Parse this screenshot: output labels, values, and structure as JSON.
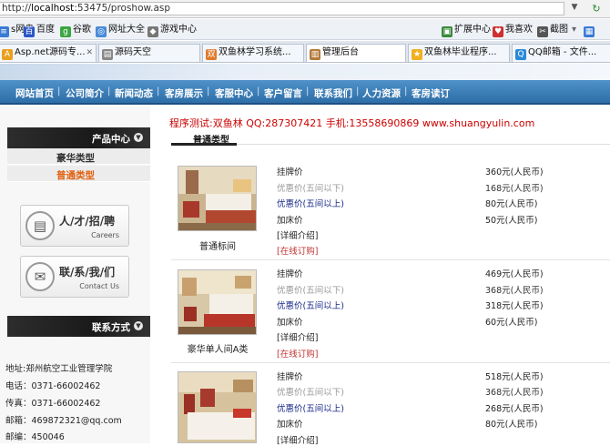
{
  "browser": {
    "url_prefix": "http://",
    "url_host": "localhost",
    "url_rest": ":53475/proshow.asp",
    "bookmarks_left": [
      {
        "label": "s网盘",
        "icon": "disk-icon",
        "color": "#3a7bd5"
      },
      {
        "label": "百度",
        "icon": "baidu-icon",
        "color": "#2b55c8"
      },
      {
        "label": "谷歌",
        "icon": "google-icon",
        "color": "#3aa640"
      },
      {
        "label": "网址大全",
        "icon": "globe-icon",
        "color": "#4a8ad8"
      },
      {
        "label": "游戏中心",
        "icon": "gamepad-icon",
        "color": "#777777"
      }
    ],
    "bookmarks_right": [
      {
        "label": "扩展中心",
        "icon": "extension-icon",
        "color": "#3a8a3a"
      },
      {
        "label": "我喜欢",
        "icon": "heart-icon",
        "color": "#d03030"
      },
      {
        "label": "截图",
        "icon": "scissors-icon",
        "color": "#555555"
      }
    ],
    "tabs": [
      {
        "label": "Asp.net源码专...",
        "icon": "page-icon"
      },
      {
        "label": "源码天空",
        "icon": "page-icon"
      },
      {
        "label": "双鱼林学习系统...",
        "icon": "page-icon"
      },
      {
        "label": "管理后台",
        "icon": "page-icon"
      },
      {
        "label": "双鱼林毕业程序...",
        "icon": "star-icon"
      },
      {
        "label": "QQ邮箱 - 文件...",
        "icon": "qq-icon"
      }
    ]
  },
  "nav": {
    "items": [
      "网站首页",
      "公司简介",
      "新闻动态",
      "客房展示",
      "客服中心",
      "客户留言",
      "联系我们",
      "人力资源",
      "客房读订"
    ]
  },
  "sidebar": {
    "product_center": "产品中心",
    "categories": [
      "豪华类型",
      "普通类型"
    ],
    "jobs_label": "人/才/招/聘",
    "jobs_en": "Careers",
    "contact_box_label": "联/系/我/们",
    "contact_box_en": "Contact Us",
    "contact_header": "联系方式",
    "contact_lines": [
      "地址:郑州航空工业管理学院",
      "电话：0371-66002462",
      "传真：0371-66002462",
      "邮箱：469872321@qq.com",
      "邮编：450046"
    ]
  },
  "main": {
    "title": "程序测试:双鱼林 QQ:287307421 手机:13558690869 www.shuangyulin.com",
    "tab": "普通类型",
    "labels": {
      "list_price": "挂牌价",
      "discount_lt5": "优惠价(五间以下)",
      "discount_gte5": "优惠价(五间以上)",
      "extra_bed": "加床价",
      "detail": "[详细介绍]",
      "order": "[在线订购]"
    },
    "rooms": [
      {
        "name": "普通标间",
        "prices": [
          "360元(人民币)",
          "168元(人民币)",
          "80元(人民币)",
          "50元(人民币)"
        ]
      },
      {
        "name": "豪华单人间A类",
        "prices": [
          "469元(人民币)",
          "368元(人民币)",
          "318元(人民币)",
          "60元(人民币)"
        ]
      },
      {
        "name": "",
        "prices": [
          "518元(人民币)",
          "368元(人民币)",
          "268元(人民币)",
          "80元(人民币)"
        ]
      }
    ]
  }
}
